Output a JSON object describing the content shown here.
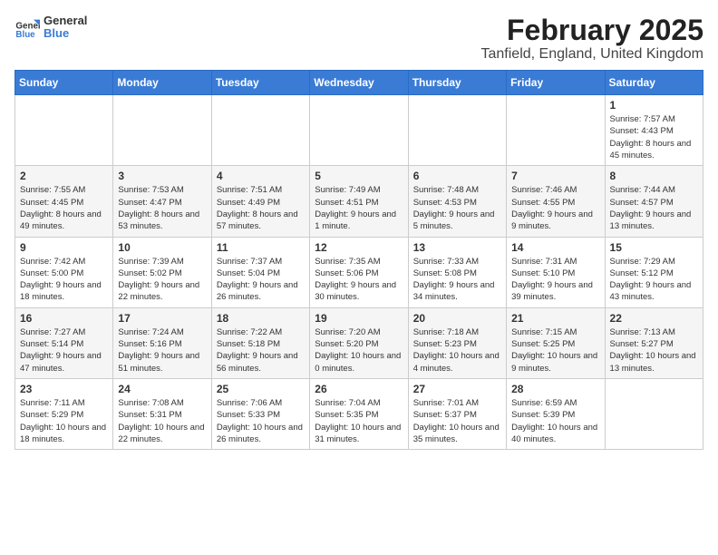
{
  "header": {
    "logo_general": "General",
    "logo_blue": "Blue",
    "month_title": "February 2025",
    "location": "Tanfield, England, United Kingdom"
  },
  "weekdays": [
    "Sunday",
    "Monday",
    "Tuesday",
    "Wednesday",
    "Thursday",
    "Friday",
    "Saturday"
  ],
  "weeks": [
    [
      {
        "day": "",
        "info": ""
      },
      {
        "day": "",
        "info": ""
      },
      {
        "day": "",
        "info": ""
      },
      {
        "day": "",
        "info": ""
      },
      {
        "day": "",
        "info": ""
      },
      {
        "day": "",
        "info": ""
      },
      {
        "day": "1",
        "info": "Sunrise: 7:57 AM\nSunset: 4:43 PM\nDaylight: 8 hours and 45 minutes."
      }
    ],
    [
      {
        "day": "2",
        "info": "Sunrise: 7:55 AM\nSunset: 4:45 PM\nDaylight: 8 hours and 49 minutes."
      },
      {
        "day": "3",
        "info": "Sunrise: 7:53 AM\nSunset: 4:47 PM\nDaylight: 8 hours and 53 minutes."
      },
      {
        "day": "4",
        "info": "Sunrise: 7:51 AM\nSunset: 4:49 PM\nDaylight: 8 hours and 57 minutes."
      },
      {
        "day": "5",
        "info": "Sunrise: 7:49 AM\nSunset: 4:51 PM\nDaylight: 9 hours and 1 minute."
      },
      {
        "day": "6",
        "info": "Sunrise: 7:48 AM\nSunset: 4:53 PM\nDaylight: 9 hours and 5 minutes."
      },
      {
        "day": "7",
        "info": "Sunrise: 7:46 AM\nSunset: 4:55 PM\nDaylight: 9 hours and 9 minutes."
      },
      {
        "day": "8",
        "info": "Sunrise: 7:44 AM\nSunset: 4:57 PM\nDaylight: 9 hours and 13 minutes."
      }
    ],
    [
      {
        "day": "9",
        "info": "Sunrise: 7:42 AM\nSunset: 5:00 PM\nDaylight: 9 hours and 18 minutes."
      },
      {
        "day": "10",
        "info": "Sunrise: 7:39 AM\nSunset: 5:02 PM\nDaylight: 9 hours and 22 minutes."
      },
      {
        "day": "11",
        "info": "Sunrise: 7:37 AM\nSunset: 5:04 PM\nDaylight: 9 hours and 26 minutes."
      },
      {
        "day": "12",
        "info": "Sunrise: 7:35 AM\nSunset: 5:06 PM\nDaylight: 9 hours and 30 minutes."
      },
      {
        "day": "13",
        "info": "Sunrise: 7:33 AM\nSunset: 5:08 PM\nDaylight: 9 hours and 34 minutes."
      },
      {
        "day": "14",
        "info": "Sunrise: 7:31 AM\nSunset: 5:10 PM\nDaylight: 9 hours and 39 minutes."
      },
      {
        "day": "15",
        "info": "Sunrise: 7:29 AM\nSunset: 5:12 PM\nDaylight: 9 hours and 43 minutes."
      }
    ],
    [
      {
        "day": "16",
        "info": "Sunrise: 7:27 AM\nSunset: 5:14 PM\nDaylight: 9 hours and 47 minutes."
      },
      {
        "day": "17",
        "info": "Sunrise: 7:24 AM\nSunset: 5:16 PM\nDaylight: 9 hours and 51 minutes."
      },
      {
        "day": "18",
        "info": "Sunrise: 7:22 AM\nSunset: 5:18 PM\nDaylight: 9 hours and 56 minutes."
      },
      {
        "day": "19",
        "info": "Sunrise: 7:20 AM\nSunset: 5:20 PM\nDaylight: 10 hours and 0 minutes."
      },
      {
        "day": "20",
        "info": "Sunrise: 7:18 AM\nSunset: 5:23 PM\nDaylight: 10 hours and 4 minutes."
      },
      {
        "day": "21",
        "info": "Sunrise: 7:15 AM\nSunset: 5:25 PM\nDaylight: 10 hours and 9 minutes."
      },
      {
        "day": "22",
        "info": "Sunrise: 7:13 AM\nSunset: 5:27 PM\nDaylight: 10 hours and 13 minutes."
      }
    ],
    [
      {
        "day": "23",
        "info": "Sunrise: 7:11 AM\nSunset: 5:29 PM\nDaylight: 10 hours and 18 minutes."
      },
      {
        "day": "24",
        "info": "Sunrise: 7:08 AM\nSunset: 5:31 PM\nDaylight: 10 hours and 22 minutes."
      },
      {
        "day": "25",
        "info": "Sunrise: 7:06 AM\nSunset: 5:33 PM\nDaylight: 10 hours and 26 minutes."
      },
      {
        "day": "26",
        "info": "Sunrise: 7:04 AM\nSunset: 5:35 PM\nDaylight: 10 hours and 31 minutes."
      },
      {
        "day": "27",
        "info": "Sunrise: 7:01 AM\nSunset: 5:37 PM\nDaylight: 10 hours and 35 minutes."
      },
      {
        "day": "28",
        "info": "Sunrise: 6:59 AM\nSunset: 5:39 PM\nDaylight: 10 hours and 40 minutes."
      },
      {
        "day": "",
        "info": ""
      }
    ]
  ]
}
